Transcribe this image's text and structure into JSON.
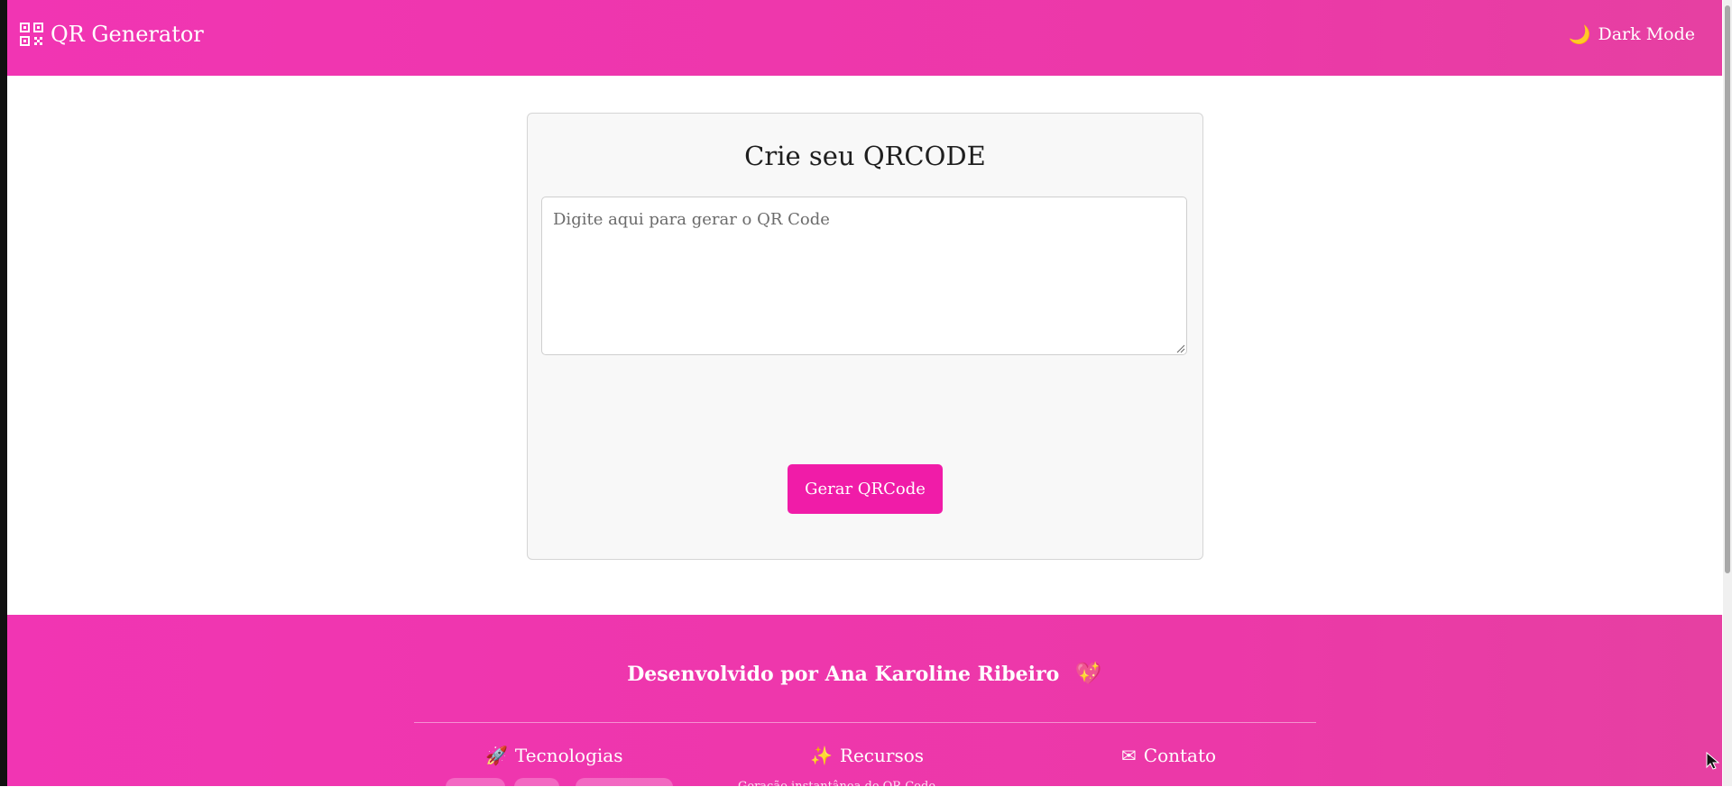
{
  "navbar": {
    "brand_label": "QR Generator",
    "dark_mode_label": "Dark Mode"
  },
  "card": {
    "title": "Crie seu QRCODE",
    "input_placeholder": "Digite aqui para gerar o QR Code",
    "input_value": "",
    "generate_button_label": "Gerar QRCode"
  },
  "footer": {
    "credit_text": "Desenvolvido por Ana Karoline Ribeiro",
    "columns": [
      {
        "label": "Tecnologias",
        "icon": "rocket-icon"
      },
      {
        "label": "Recursos",
        "icon": "sparkles-icon"
      },
      {
        "label": "Contato",
        "icon": "envelope-icon"
      }
    ],
    "partial_text": "Geração instantânea de QR Code"
  },
  "colors": {
    "accent": "#f01ca8",
    "header_bg": "#f135b3"
  }
}
